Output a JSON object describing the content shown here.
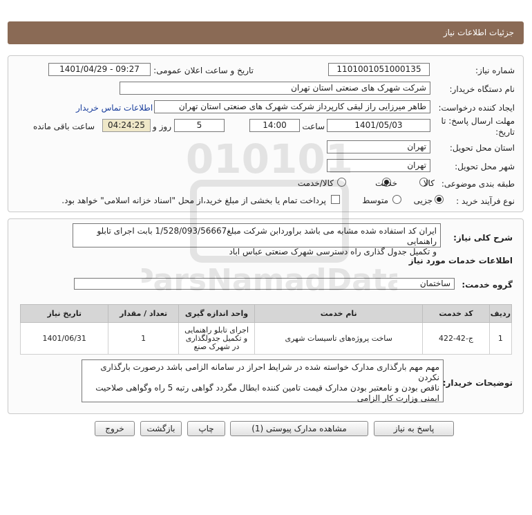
{
  "header": {
    "title": "جزئیات اطلاعات نیاز"
  },
  "form": {
    "need_number_label": "شماره نیاز:",
    "need_number": "1101001051000135",
    "announce_label": "تاریخ و ساعت اعلان عمومی:",
    "announce_value": "1401/04/29 - 09:27",
    "buyer_label": "نام دستگاه خریدار:",
    "buyer_value": "شرکت شهرک های صنعتی استان تهران",
    "creator_label": "ایجاد کننده درخواست:",
    "creator_value": "طاهر  میرزایی راز لیقی کارپرداز شرکت شهرک های صنعتی استان تهران",
    "contact_link": "اطلاعات تماس خریدار",
    "deadline_label_1": "مهلت ارسال پاسخ: تا",
    "deadline_label_2": "تاریخ:",
    "deadline_date": "1401/05/03",
    "time_label": "ساعت",
    "deadline_time": "14:00",
    "days_value": "5",
    "days_label": "روز و",
    "remaining_value": "04:24:25",
    "remaining_label": "ساعت باقی مانده",
    "province_label": "استان محل تحویل:",
    "province_value": "تهران",
    "city_label": "شهر محل تحویل:",
    "city_value": "تهران",
    "category_label": "طبقه بندی موضوعی:",
    "category_options": [
      "کالا",
      "خدمت",
      "کالا/خدمت"
    ],
    "category_selected": "خدمت",
    "process_label": "نوع فرآیند خرید :",
    "process_options": [
      "جزیی",
      "متوسط"
    ],
    "process_selected": "جزیی",
    "payment_text": "پرداخت تمام یا بخشی از مبلغ خرید،از محل \"اسناد خزانه اسلامی\" خواهد بود."
  },
  "summary": {
    "label": "شرح کلی نیاز:",
    "text_line1": "ایران کد استفاده شده مشابه می باشد براوردابن شرکت مبلغ1/528/093/56667  بابت اجرای تابلو راهنمایی",
    "text_line2": "و تکمیل جدول گذاری راه دسترسی شهرک صنعتی عباس اباد",
    "services_heading": "اطلاعات خدمات مورد نیاز",
    "service_group_label": "گروه خدمت:",
    "service_group_value": "ساختمان"
  },
  "table": {
    "headers": [
      "ردیف",
      "کد خدمت",
      "نام خدمت",
      "واحد اندازه گیری",
      "تعداد / مقدار",
      "تاریخ نیاز"
    ],
    "rows": [
      {
        "index": "1",
        "code": "ج-42-422",
        "name": "ساخت پروژه‌های تاسیسات شهری",
        "unit": "اجرای تابلو راهنمایی و تکمیل جدولگذاری در شهرک صنع",
        "qty": "1",
        "date": "1401/06/31"
      }
    ]
  },
  "buyer_notes": {
    "label": "توضیحات خریدار:",
    "line1": "مهم مهم بارگذاری مدارک خواسته شده در شرایط احراز در سامانه الزامی باشد درصورت بارگذاری نکردن",
    "line2": "ناقص بودن و نامعتبر بودن مدارک قیمت تامین کننده ابطال مگردد گواهی رتبه 5 راه وگواهی صلاحیت",
    "line3": "ایمنی وزارت کار الزامی"
  },
  "buttons": {
    "reply": "پاسخ به نیاز",
    "view_docs": "مشاهده مدارک پیوستی (1)",
    "print": "چاپ",
    "back": "بازگشت",
    "exit": "خروج"
  },
  "watermark": {
    "digits": "010101",
    "brand": "ParsNamadData"
  }
}
